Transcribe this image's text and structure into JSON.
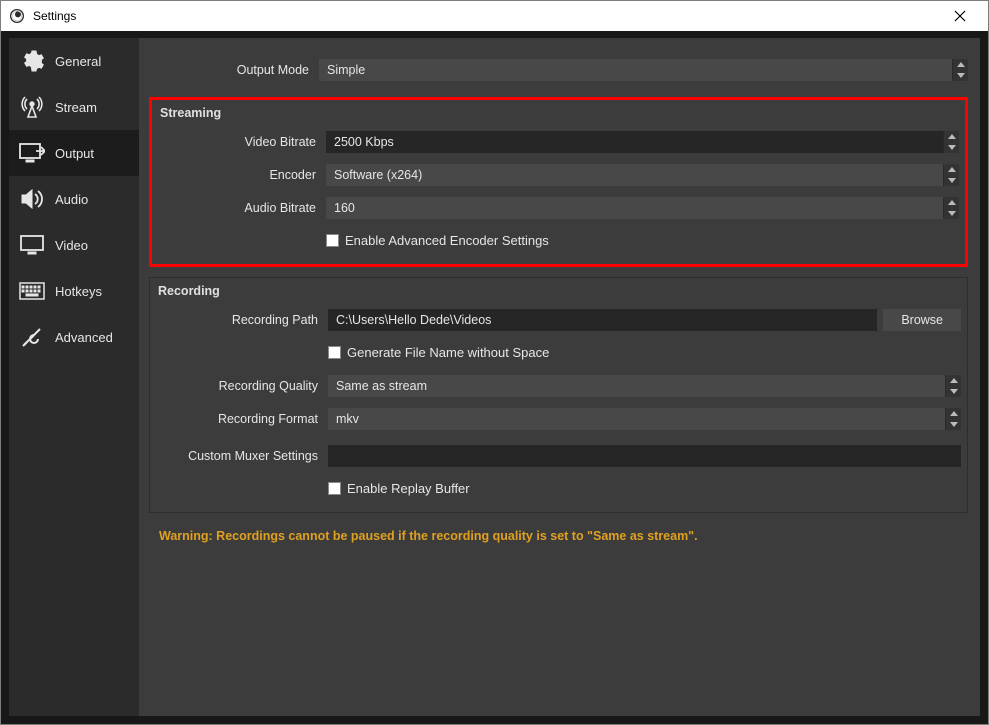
{
  "window": {
    "title": "Settings"
  },
  "sidebar": {
    "items": [
      {
        "label": "General"
      },
      {
        "label": "Stream"
      },
      {
        "label": "Output",
        "active": true
      },
      {
        "label": "Audio"
      },
      {
        "label": "Video"
      },
      {
        "label": "Hotkeys"
      },
      {
        "label": "Advanced"
      }
    ]
  },
  "output": {
    "mode_label": "Output Mode",
    "mode_value": "Simple",
    "streaming": {
      "title": "Streaming",
      "video_bitrate_label": "Video Bitrate",
      "video_bitrate_value": "2500 Kbps",
      "encoder_label": "Encoder",
      "encoder_value": "Software (x264)",
      "audio_bitrate_label": "Audio Bitrate",
      "audio_bitrate_value": "160",
      "advanced_chk_label": "Enable Advanced Encoder Settings"
    },
    "recording": {
      "title": "Recording",
      "path_label": "Recording Path",
      "path_value": "C:\\Users\\Hello Dede\\Videos",
      "browse_label": "Browse",
      "gen_filename_label": "Generate File Name without Space",
      "quality_label": "Recording Quality",
      "quality_value": "Same as stream",
      "format_label": "Recording Format",
      "format_value": "mkv",
      "muxer_label": "Custom Muxer Settings",
      "muxer_value": "",
      "replay_label": "Enable Replay Buffer"
    },
    "warning": "Warning: Recordings cannot be paused if the recording quality is set to \"Same as stream\"."
  }
}
